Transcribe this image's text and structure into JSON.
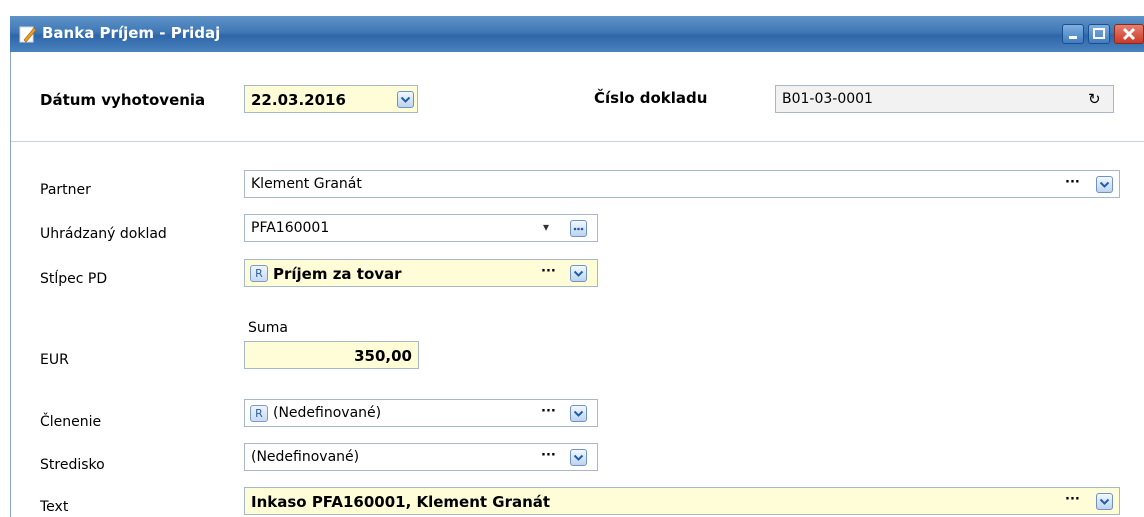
{
  "window": {
    "title": "Banka Príjem - Pridaj"
  },
  "header": {
    "date_label": "Dátum vyhotovenia",
    "date_value": "22.03.2016",
    "docnum_label": "Číslo dokladu",
    "docnum_value": "B01-03-0001"
  },
  "form": {
    "partner_label": "Partner",
    "partner_value": "Klement  Granát",
    "paid_doc_label": "Uhrádzaný doklad",
    "paid_doc_value": "PFA160001",
    "column_label": "Stĺpec PD",
    "column_tag": "R",
    "column_value": "Príjem za tovar",
    "sum_header": "Suma",
    "currency_label": "EUR",
    "sum_value": "350,00",
    "division_label": "Členenie",
    "division_tag": "R",
    "division_value": "(Nedefinované)",
    "center_label": "Stredisko",
    "center_value": "(Nedefinované)",
    "text_label": "Text",
    "text_value": "Inkaso PFA160001, Klement  Granát"
  },
  "glyphs": {
    "dots": "···",
    "caret": "▾",
    "refresh": "↻"
  },
  "colors": {
    "title_bar": "#3f78b5",
    "highlight_field": "#fffcd8"
  }
}
